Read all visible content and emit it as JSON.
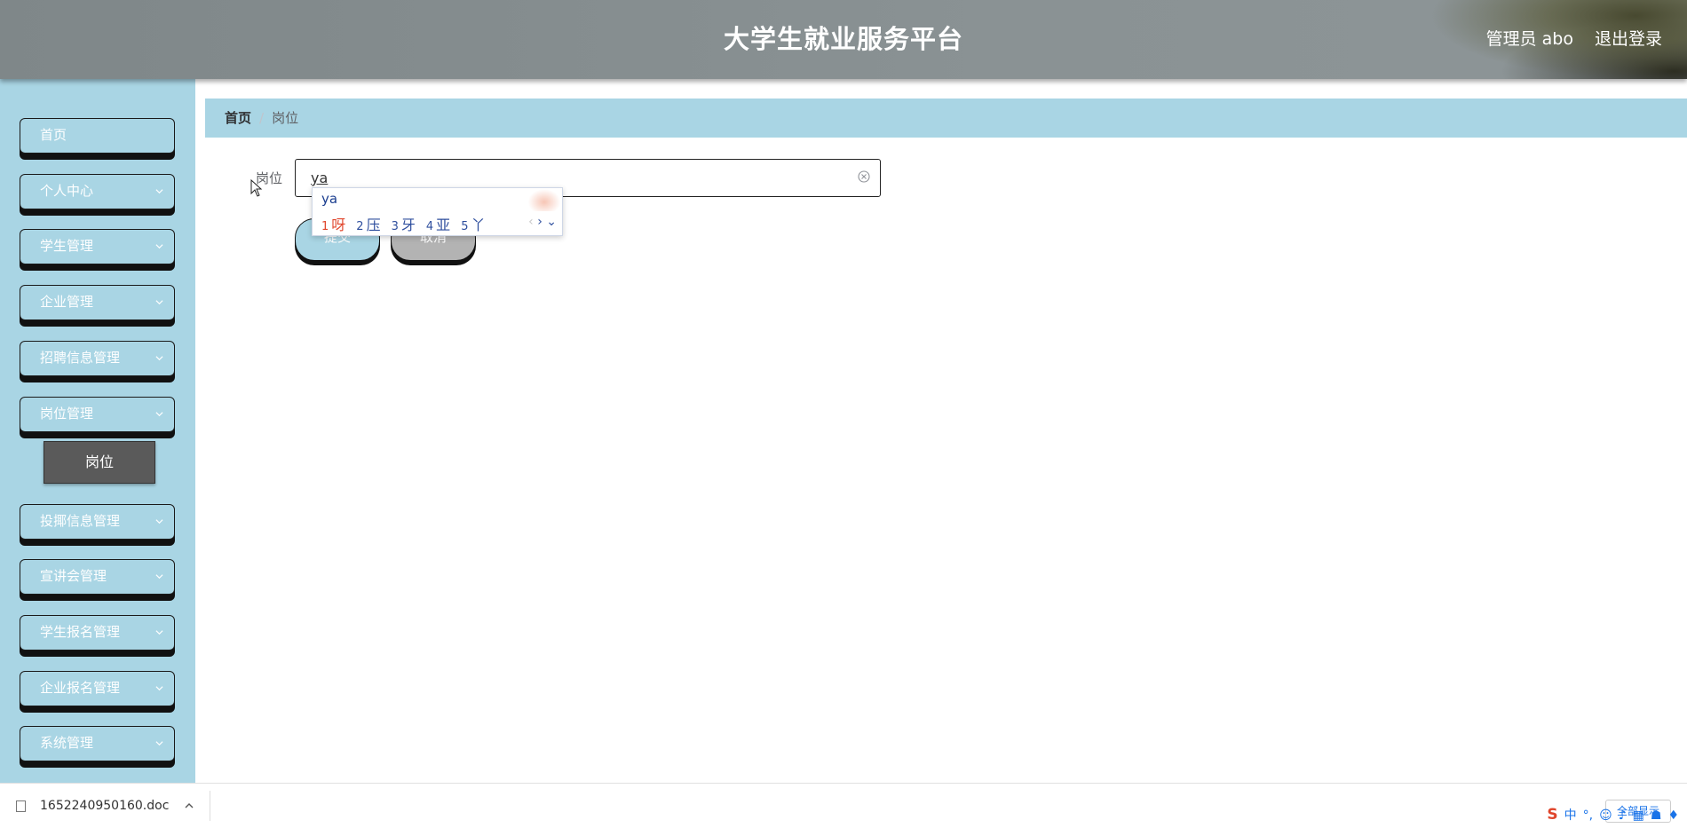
{
  "header": {
    "title": "大学生就业服务平台",
    "user": "管理员 abo",
    "logout": "退出登录"
  },
  "sidebar": {
    "items": [
      {
        "label": "首页",
        "has_children": false
      },
      {
        "label": "个人中心",
        "has_children": true
      },
      {
        "label": "学生管理",
        "has_children": true
      },
      {
        "label": "企业管理",
        "has_children": true
      },
      {
        "label": "招聘信息管理",
        "has_children": true
      },
      {
        "label": "岗位管理",
        "has_children": true
      },
      {
        "label": "投揶信息管理",
        "has_children": true
      },
      {
        "label": "宣讲会管理",
        "has_children": true
      },
      {
        "label": "学生报名管理",
        "has_children": true
      },
      {
        "label": "企业报名管理",
        "has_children": true
      },
      {
        "label": "系统管理",
        "has_children": true
      }
    ],
    "active_sub": "岗位"
  },
  "breadcrumb": {
    "home": "首页",
    "separator": "/",
    "current": "岗位"
  },
  "form": {
    "label": "岗位",
    "value": "ya",
    "submit": "提交",
    "cancel": "取消"
  },
  "ime": {
    "composition": "ya",
    "candidates": [
      {
        "n": "1",
        "ch": "呀"
      },
      {
        "n": "2",
        "ch": "压"
      },
      {
        "n": "3",
        "ch": "牙"
      },
      {
        "n": "4",
        "ch": "亚"
      },
      {
        "n": "5",
        "ch": "丫"
      }
    ],
    "prev": "‹",
    "next": "›",
    "expand": "⌄"
  },
  "download_bar": {
    "filename": "1652240950160.doc",
    "show_all": "全部显示"
  },
  "tray": {
    "logo": "S",
    "lang": "中",
    "punct": "°,"
  },
  "colors": {
    "accent": "#a9d5e4",
    "header": "#858d8f",
    "active_sub": "#5a5a5a"
  }
}
